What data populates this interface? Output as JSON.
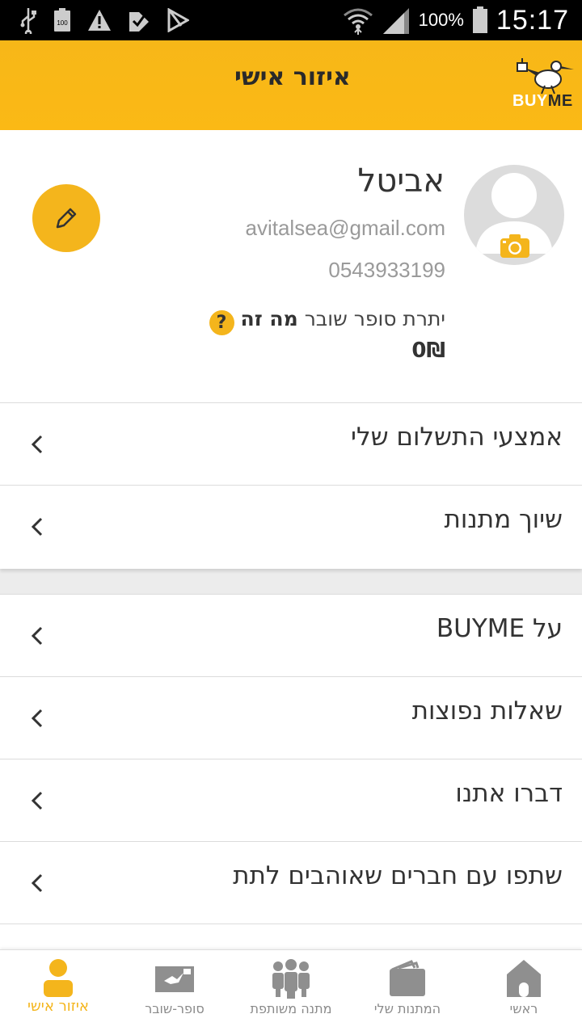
{
  "status_bar": {
    "battery_level": "100%",
    "time": "15:17",
    "icons": [
      "usb-icon",
      "battery-full-icon",
      "warning-icon",
      "check-icon",
      "play-store-icon",
      "wifi-icon",
      "signal-icon",
      "battery-icon"
    ]
  },
  "header": {
    "title": "איזור אישי",
    "logo_buy": "BUY",
    "logo_me": "ME"
  },
  "profile": {
    "name": "אביטל",
    "email": "avitalsea@gmail.com",
    "phone": "0543933199",
    "balance_label": "יתרת סופר שובר",
    "whatis_label": "מה זה",
    "help_symbol": "?",
    "balance_amount": "0₪"
  },
  "menu_group_1": [
    {
      "label": "אמצעי התשלום שלי"
    },
    {
      "label": "שיוך מתנות"
    }
  ],
  "menu_group_2": [
    {
      "label": "על BUYME"
    },
    {
      "label": "שאלות נפוצות"
    },
    {
      "label": "דברו אתנו"
    },
    {
      "label": "שתפו עם חברים שאוהבים לתת"
    }
  ],
  "bottom_nav": [
    {
      "label": "איזור אישי",
      "icon": "person-icon",
      "active": true
    },
    {
      "label": "סופר-שובר",
      "icon": "voucher-icon",
      "active": false
    },
    {
      "label": "מתנה משותפת",
      "icon": "group-icon",
      "active": false
    },
    {
      "label": "המתנות שלי",
      "icon": "wallet-icon",
      "active": false
    },
    {
      "label": "ראשי",
      "icon": "home-icon",
      "active": false
    }
  ],
  "colors": {
    "accent": "#f4b51c",
    "header": "#fbb915",
    "text": "#333333",
    "muted": "#9a9a9a"
  }
}
